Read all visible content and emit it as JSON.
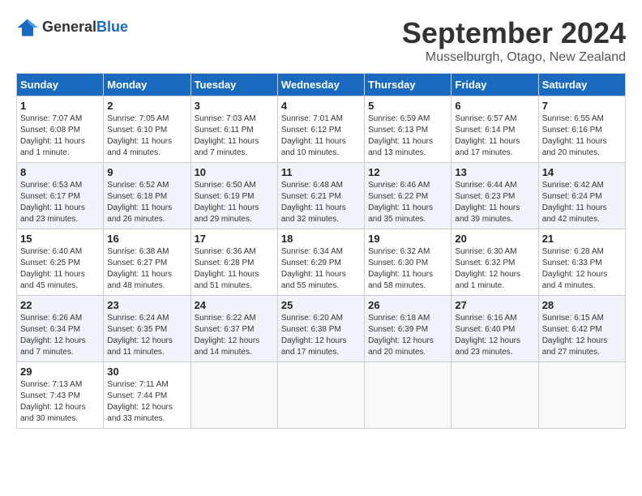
{
  "header": {
    "logo_general": "General",
    "logo_blue": "Blue",
    "month_title": "September 2024",
    "location": "Musselburgh, Otago, New Zealand"
  },
  "calendar": {
    "days_of_week": [
      "Sunday",
      "Monday",
      "Tuesday",
      "Wednesday",
      "Thursday",
      "Friday",
      "Saturday"
    ],
    "weeks": [
      [
        {
          "day": "1",
          "info": "Sunrise: 7:07 AM\nSunset: 6:08 PM\nDaylight: 11 hours\nand 1 minute."
        },
        {
          "day": "2",
          "info": "Sunrise: 7:05 AM\nSunset: 6:10 PM\nDaylight: 11 hours\nand 4 minutes."
        },
        {
          "day": "3",
          "info": "Sunrise: 7:03 AM\nSunset: 6:11 PM\nDaylight: 11 hours\nand 7 minutes."
        },
        {
          "day": "4",
          "info": "Sunrise: 7:01 AM\nSunset: 6:12 PM\nDaylight: 11 hours\nand 10 minutes."
        },
        {
          "day": "5",
          "info": "Sunrise: 6:59 AM\nSunset: 6:13 PM\nDaylight: 11 hours\nand 13 minutes."
        },
        {
          "day": "6",
          "info": "Sunrise: 6:57 AM\nSunset: 6:14 PM\nDaylight: 11 hours\nand 17 minutes."
        },
        {
          "day": "7",
          "info": "Sunrise: 6:55 AM\nSunset: 6:16 PM\nDaylight: 11 hours\nand 20 minutes."
        }
      ],
      [
        {
          "day": "8",
          "info": "Sunrise: 6:53 AM\nSunset: 6:17 PM\nDaylight: 11 hours\nand 23 minutes."
        },
        {
          "day": "9",
          "info": "Sunrise: 6:52 AM\nSunset: 6:18 PM\nDaylight: 11 hours\nand 26 minutes."
        },
        {
          "day": "10",
          "info": "Sunrise: 6:50 AM\nSunset: 6:19 PM\nDaylight: 11 hours\nand 29 minutes."
        },
        {
          "day": "11",
          "info": "Sunrise: 6:48 AM\nSunset: 6:21 PM\nDaylight: 11 hours\nand 32 minutes."
        },
        {
          "day": "12",
          "info": "Sunrise: 6:46 AM\nSunset: 6:22 PM\nDaylight: 11 hours\nand 35 minutes."
        },
        {
          "day": "13",
          "info": "Sunrise: 6:44 AM\nSunset: 6:23 PM\nDaylight: 11 hours\nand 39 minutes."
        },
        {
          "day": "14",
          "info": "Sunrise: 6:42 AM\nSunset: 6:24 PM\nDaylight: 11 hours\nand 42 minutes."
        }
      ],
      [
        {
          "day": "15",
          "info": "Sunrise: 6:40 AM\nSunset: 6:25 PM\nDaylight: 11 hours\nand 45 minutes."
        },
        {
          "day": "16",
          "info": "Sunrise: 6:38 AM\nSunset: 6:27 PM\nDaylight: 11 hours\nand 48 minutes."
        },
        {
          "day": "17",
          "info": "Sunrise: 6:36 AM\nSunset: 6:28 PM\nDaylight: 11 hours\nand 51 minutes."
        },
        {
          "day": "18",
          "info": "Sunrise: 6:34 AM\nSunset: 6:29 PM\nDaylight: 11 hours\nand 55 minutes."
        },
        {
          "day": "19",
          "info": "Sunrise: 6:32 AM\nSunset: 6:30 PM\nDaylight: 11 hours\nand 58 minutes."
        },
        {
          "day": "20",
          "info": "Sunrise: 6:30 AM\nSunset: 6:32 PM\nDaylight: 12 hours\nand 1 minute."
        },
        {
          "day": "21",
          "info": "Sunrise: 6:28 AM\nSunset: 6:33 PM\nDaylight: 12 hours\nand 4 minutes."
        }
      ],
      [
        {
          "day": "22",
          "info": "Sunrise: 6:26 AM\nSunset: 6:34 PM\nDaylight: 12 hours\nand 7 minutes."
        },
        {
          "day": "23",
          "info": "Sunrise: 6:24 AM\nSunset: 6:35 PM\nDaylight: 12 hours\nand 11 minutes."
        },
        {
          "day": "24",
          "info": "Sunrise: 6:22 AM\nSunset: 6:37 PM\nDaylight: 12 hours\nand 14 minutes."
        },
        {
          "day": "25",
          "info": "Sunrise: 6:20 AM\nSunset: 6:38 PM\nDaylight: 12 hours\nand 17 minutes."
        },
        {
          "day": "26",
          "info": "Sunrise: 6:18 AM\nSunset: 6:39 PM\nDaylight: 12 hours\nand 20 minutes."
        },
        {
          "day": "27",
          "info": "Sunrise: 6:16 AM\nSunset: 6:40 PM\nDaylight: 12 hours\nand 23 minutes."
        },
        {
          "day": "28",
          "info": "Sunrise: 6:15 AM\nSunset: 6:42 PM\nDaylight: 12 hours\nand 27 minutes."
        }
      ],
      [
        {
          "day": "29",
          "info": "Sunrise: 7:13 AM\nSunset: 7:43 PM\nDaylight: 12 hours\nand 30 minutes."
        },
        {
          "day": "30",
          "info": "Sunrise: 7:11 AM\nSunset: 7:44 PM\nDaylight: 12 hours\nand 33 minutes."
        },
        {
          "day": "",
          "info": ""
        },
        {
          "day": "",
          "info": ""
        },
        {
          "day": "",
          "info": ""
        },
        {
          "day": "",
          "info": ""
        },
        {
          "day": "",
          "info": ""
        }
      ]
    ]
  }
}
